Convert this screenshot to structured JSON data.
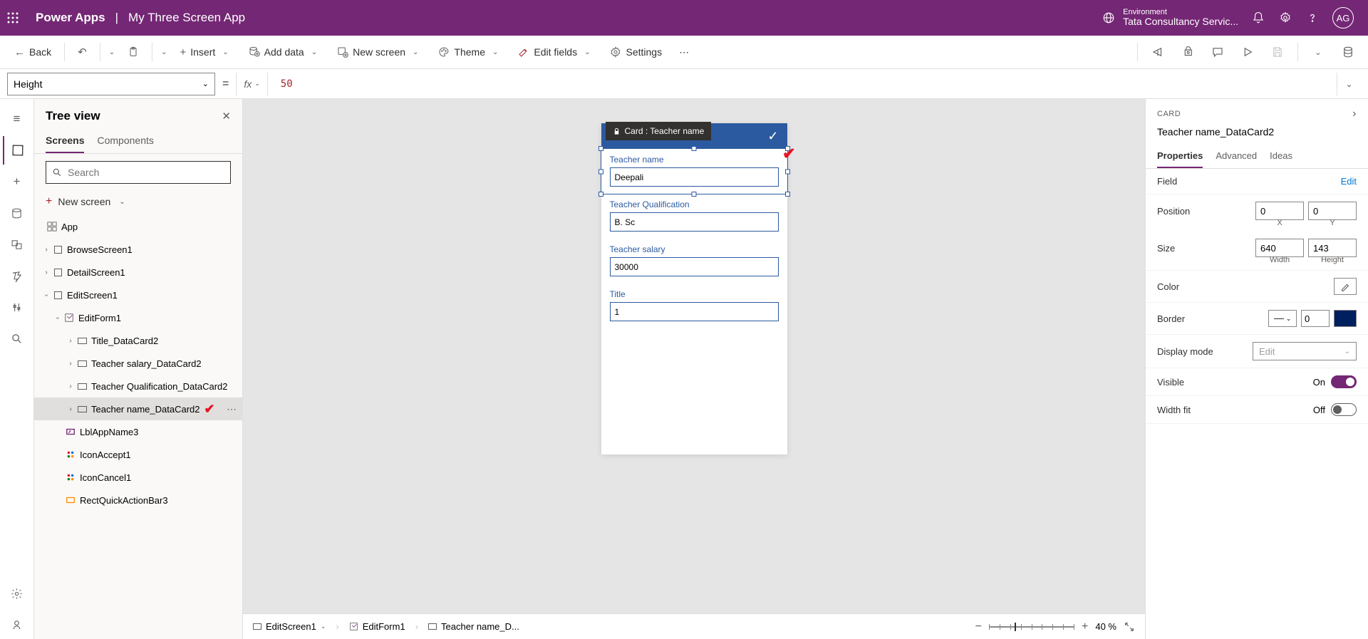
{
  "header": {
    "product": "Power Apps",
    "separator": "|",
    "app_name": "My Three Screen App",
    "env_label": "Environment",
    "env_value": "Tata Consultancy Servic...",
    "avatar": "AG"
  },
  "cmdbar": {
    "back": "Back",
    "insert": "Insert",
    "add_data": "Add data",
    "new_screen": "New screen",
    "theme": "Theme",
    "edit_fields": "Edit fields",
    "settings": "Settings"
  },
  "formulabar": {
    "property": "Height",
    "fx": "fx",
    "value": "50"
  },
  "tree": {
    "title": "Tree view",
    "tabs": {
      "screens": "Screens",
      "components": "Components"
    },
    "search_placeholder": "Search",
    "new_screen": "New screen",
    "items": {
      "app": "App",
      "browse": "BrowseScreen1",
      "detail": "DetailScreen1",
      "edit": "EditScreen1",
      "editform": "EditForm1",
      "title_card": "Title_DataCard2",
      "salary_card": "Teacher salary_DataCard2",
      "qual_card": "Teacher Qualification_DataCard2",
      "name_card": "Teacher name_DataCard2",
      "lblapp": "LblAppName3",
      "iconaccept": "IconAccept1",
      "iconcancel": "IconCancel1",
      "rect": "RectQuickActionBar3"
    }
  },
  "canvas": {
    "tooltip": "Card : Teacher name",
    "fields": {
      "name": {
        "label": "Teacher name",
        "value": "Deepali"
      },
      "qual": {
        "label": "Teacher Qualification",
        "value": "B. Sc"
      },
      "salary": {
        "label": "Teacher salary",
        "value": "30000"
      },
      "title": {
        "label": "Title",
        "value": "1"
      }
    }
  },
  "breadcrumb": {
    "screen": "EditScreen1",
    "form": "EditForm1",
    "card": "Teacher name_D...",
    "zoom": "40  %"
  },
  "props": {
    "category": "CARD",
    "name": "Teacher name_DataCard2",
    "tabs": {
      "properties": "Properties",
      "advanced": "Advanced",
      "ideas": "Ideas"
    },
    "field_label": "Field",
    "field_edit": "Edit",
    "position_label": "Position",
    "position_x": "0",
    "position_y": "0",
    "xcap": "X",
    "ycap": "Y",
    "size_label": "Size",
    "size_w": "640",
    "size_h": "143",
    "wcap": "Width",
    "hcap": "Height",
    "color_label": "Color",
    "border_label": "Border",
    "border_val": "0",
    "display_label": "Display mode",
    "display_val": "Edit",
    "visible_label": "Visible",
    "visible_val": "On",
    "widthfit_label": "Width fit",
    "widthfit_val": "Off"
  }
}
